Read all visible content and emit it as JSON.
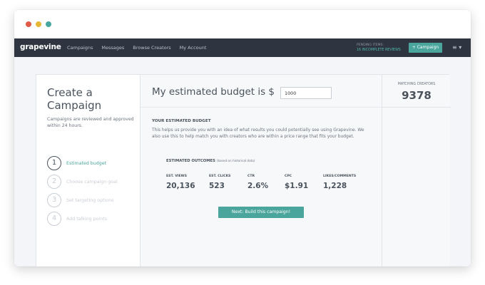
{
  "navbar": {
    "brand": "grapevine",
    "links": [
      "Campaigns",
      "Messages",
      "Browse Creators",
      "My Account"
    ],
    "pending_label": "PENDING ITEMS:",
    "pending_value": "16 INCOMPLETE REVIEWS",
    "campaign_button": "+ Campaign",
    "menu_icon": "≡ ▾"
  },
  "sidebar": {
    "title_line1": "Create a",
    "title_line2": "Campaign",
    "subtitle": "Campaigns are reviewed and approved within 24 hours.",
    "steps": [
      {
        "num": "1",
        "label": "Estimated budget"
      },
      {
        "num": "2",
        "label": "Choose campaign goal"
      },
      {
        "num": "3",
        "label": "Set targeting options"
      },
      {
        "num": "4",
        "label": "Add talking points"
      }
    ]
  },
  "budget": {
    "label": "My estimated budget is $",
    "value": "1000"
  },
  "estimate": {
    "title": "YOUR ESTIMATED BUDGET",
    "body": "This helps us provide you with an idea of what results you could potentially see using Grapevine. We also use this to help match you with creators who are within a price range that fits your budget."
  },
  "outcomes": {
    "title": "ESTIMATED OUTCOMES",
    "note": "(based on historical data)",
    "stats": [
      {
        "label": "EST. VIEWS",
        "value": "20,136"
      },
      {
        "label": "EST. CLICKS",
        "value": "523"
      },
      {
        "label": "CTR",
        "value": "2.6%"
      },
      {
        "label": "CPC",
        "value": "$1.91"
      },
      {
        "label": "LIKES/COMMENTS",
        "value": "1,228"
      }
    ]
  },
  "next_button": "Next: Build this campaign!",
  "matching": {
    "label": "MATCHING CREATORS",
    "value": "9378"
  },
  "colors": {
    "accent": "#4aa59c",
    "navbar": "#2e3540"
  }
}
